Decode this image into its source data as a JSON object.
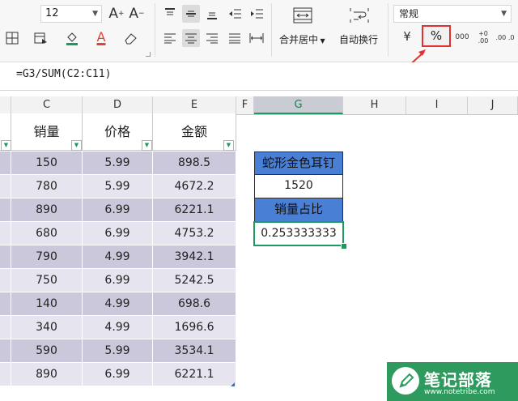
{
  "ribbon": {
    "font_size": "12",
    "number_format": "常规",
    "merge_center_label": "合并居中",
    "wrap_text_label": "自动换行",
    "currency_symbol": "¥",
    "percent_symbol": "%",
    "inc_decimal_symbol": "+0 .00",
    "dec_decimal_symbol": ".00 .0",
    "thousands_symbol": "000"
  },
  "formula_bar": {
    "content": "=G3/SUM(C2:C11)"
  },
  "columns": [
    "C",
    "D",
    "E",
    "F",
    "G",
    "H",
    "I",
    "J"
  ],
  "active_column": "G",
  "table": {
    "headers": [
      "销量",
      "价格",
      "金额"
    ],
    "rows": [
      [
        "150",
        "5.99",
        "898.5"
      ],
      [
        "780",
        "5.99",
        "4672.2"
      ],
      [
        "890",
        "6.99",
        "6221.1"
      ],
      [
        "680",
        "6.99",
        "4753.2"
      ],
      [
        "790",
        "4.99",
        "3942.1"
      ],
      [
        "750",
        "6.99",
        "5242.5"
      ],
      [
        "140",
        "4.99",
        "698.6"
      ],
      [
        "340",
        "4.99",
        "1696.6"
      ],
      [
        "590",
        "5.99",
        "3534.1"
      ],
      [
        "890",
        "6.99",
        "6221.1"
      ]
    ]
  },
  "side_cells": {
    "product_name": "蛇形金色耳钉",
    "sales_value": "1520",
    "ratio_label": "销量占比",
    "ratio_value": "0.253333333"
  },
  "watermark": {
    "name": "笔记部落",
    "url": "www.notetribe.com"
  },
  "colors": {
    "accent_green": "#1a9a5f",
    "odd_row": "#ccc8dc",
    "even_row": "#e6e4ef",
    "blue_cell": "#4a7fd6",
    "highlight_red": "#e23030",
    "logo_green": "#2f9a5e"
  }
}
